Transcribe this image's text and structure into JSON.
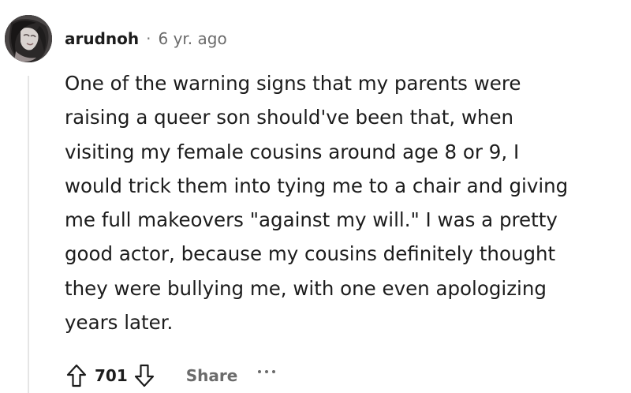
{
  "comment": {
    "author": "arudnoh",
    "separator": "·",
    "age": "6 yr. ago",
    "body_lines": [
      "One of the warning signs that my parents were",
      "raising a queer son should've been that, when",
      "visiting my female cousins around age 8 or 9, I",
      "would trick them into tying me to a chair and giving",
      "me full makeovers \"against my will.\" I was a pretty",
      "good actor, because my cousins definitely thought",
      "they were bullying me, with one even apologizing",
      "years later."
    ],
    "score": "701",
    "share_label": "Share"
  },
  "icons": {
    "upvote": "arrow-up-outline-icon",
    "downvote": "arrow-down-outline-icon",
    "more": "ellipsis-horizontal-icon"
  },
  "colors": {
    "text": "#1c1c1c",
    "meta": "#6b6b6b",
    "thread_line": "#e5e5e5"
  }
}
